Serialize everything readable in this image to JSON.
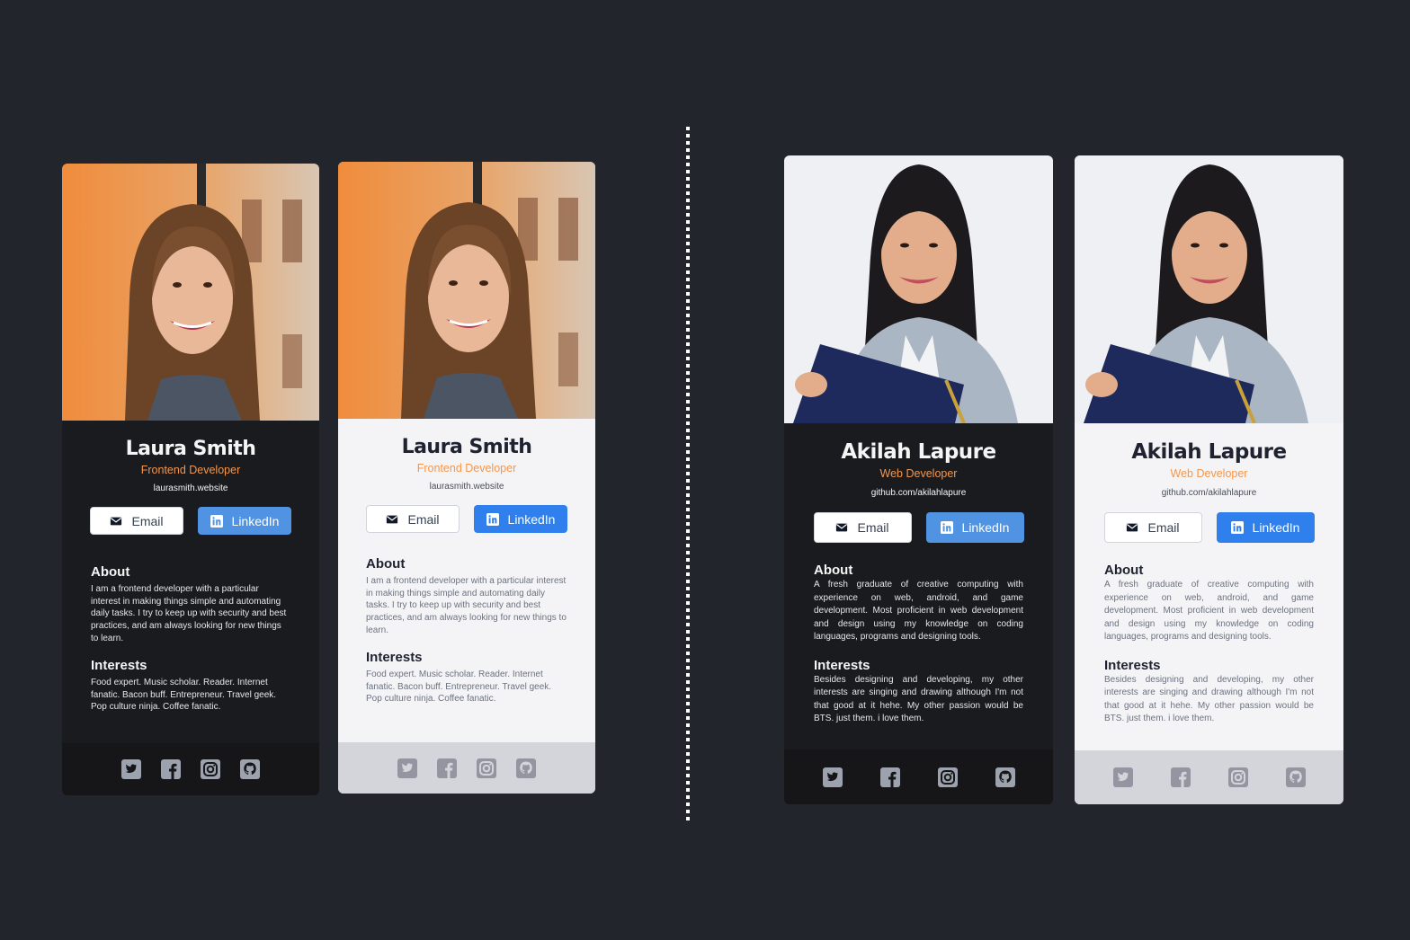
{
  "cards": [
    {
      "theme": "dark",
      "name": "Laura Smith",
      "role": "Frontend Developer",
      "website": "laurasmith.website",
      "email_label": "Email",
      "linkedin_label": "LinkedIn",
      "about_title": "About",
      "about_text": "I am a frontend developer with a particular interest in making things simple and automating daily tasks. I try to keep up with security and best practices, and am always looking for new things to learn.",
      "interests_title": "Interests",
      "interests_text": "Food expert. Music scholar. Reader. Internet fanatic. Bacon buff. Entrepreneur. Travel geek. Pop culture ninja. Coffee fanatic.",
      "social_icons": [
        "twitter-icon",
        "facebook-icon",
        "instagram-icon",
        "github-icon"
      ]
    },
    {
      "theme": "light",
      "name": "Laura Smith",
      "role": "Frontend Developer",
      "website": "laurasmith.website",
      "email_label": "Email",
      "linkedin_label": "LinkedIn",
      "about_title": "About",
      "about_text": "I am a frontend developer with a particular interest in making things simple and automating daily tasks. I try to keep up with security and best practices, and am always looking for new things to learn.",
      "interests_title": "Interests",
      "interests_text": "Food expert. Music scholar. Reader. Internet fanatic. Bacon buff. Entrepreneur. Travel geek. Pop culture ninja. Coffee fanatic.",
      "social_icons": [
        "twitter-icon",
        "facebook-icon",
        "instagram-icon",
        "github-icon"
      ]
    },
    {
      "theme": "dark",
      "name": "Akilah Lapure",
      "role": "Web Developer",
      "website": "github.com/akilahlapure",
      "email_label": "Email",
      "linkedin_label": "LinkedIn",
      "about_title": "About",
      "about_text": "A fresh graduate of creative computing with experience on web, android, and game development. Most proficient in web development and design using my knowledge on coding languages, programs and designing tools.",
      "interests_title": "Interests",
      "interests_text": "Besides designing and developing, my other interests are singing and drawing although I'm not that good at it hehe. My other passion would be BTS. just them. i love them.",
      "social_icons": [
        "twitter-icon",
        "facebook-icon",
        "instagram-icon",
        "github-icon"
      ]
    },
    {
      "theme": "light",
      "name": "Akilah Lapure",
      "role": "Web Developer",
      "website": "github.com/akilahlapure",
      "email_label": "Email",
      "linkedin_label": "LinkedIn",
      "about_title": "About",
      "about_text": "A fresh graduate of creative computing with experience on web, android, and game development. Most proficient in web development and design using my knowledge on coding languages, programs and designing tools.",
      "interests_title": "Interests",
      "interests_text": "Besides designing and developing, my other interests are singing and drawing although I'm not that good at it hehe. My other passion would be BTS. just them. i love them.",
      "social_icons": [
        "twitter-icon",
        "facebook-icon",
        "instagram-icon",
        "github-icon"
      ]
    }
  ],
  "colors": {
    "page_background": "#23252c",
    "dark_card": "#1a1b1f",
    "light_card": "#f4f4f6",
    "accent_orange": "#f3964c",
    "linkedin_blue": "#2f80ed",
    "divider": "#ffffff"
  }
}
